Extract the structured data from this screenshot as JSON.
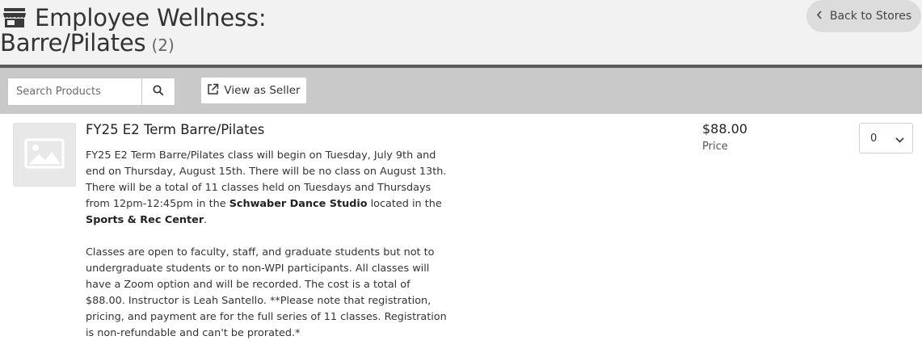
{
  "header": {
    "title_line1": "Employee Wellness:",
    "title_line2": "Barre/Pilates",
    "count": "(2)",
    "store_icon": "store-icon",
    "back_button": {
      "label": "Back to Stores",
      "icon": "chevron-left-icon"
    }
  },
  "toolbar": {
    "search": {
      "placeholder": "Search Products",
      "value": "",
      "icon": "search-icon"
    },
    "view_as_seller": {
      "label": "View as Seller",
      "icon": "external-link-icon"
    }
  },
  "product": {
    "image_icon": "image-placeholder-icon",
    "title": "FY25 E2 Term Barre/Pilates",
    "desc_p1_a": "FY25 E2 Term Barre/Pilates class will begin on Tuesday, July 9th and end on Thursday, August 15th. There will be no class on August 13th. There will be a total of 11 classes held on Tuesdays and Thursdays from 12pm-12:45pm in the ",
    "desc_p1_b": "Schwaber Dance Studio",
    "desc_p1_c": " located in the ",
    "desc_p1_d": "Sports & Rec Center",
    "desc_p1_e": ".",
    "desc_p2": "Classes are open to faculty, staff, and graduate students but not to undergraduate students or to non-WPI participants. All classes will have a Zoom option and will be recorded. The cost is a total of $88.00. Instructor is Leah Santello. **Please note that registration, pricing, and payment are for the full series of 11 classes. Registration is non-refundable and can't be prorated.*",
    "price": "$88.00",
    "price_label": "Price",
    "quantity": "0",
    "quantity_icon": "chevron-down-icon"
  }
}
